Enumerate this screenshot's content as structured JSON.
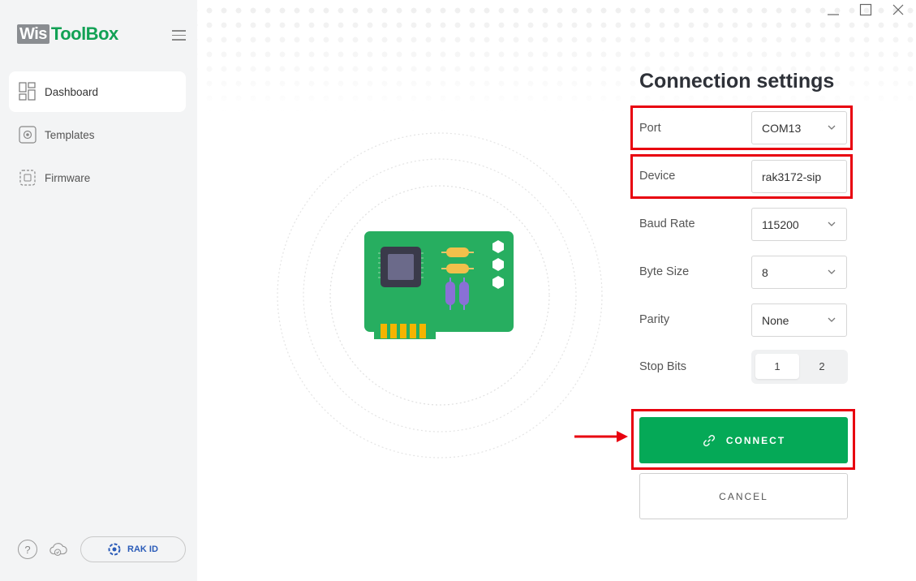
{
  "app": {
    "logo_wis": "Wis",
    "logo_toolbox": "ToolBox"
  },
  "sidebar": {
    "items": [
      {
        "label": "Dashboard",
        "icon": "dashboard-icon",
        "active": true
      },
      {
        "label": "Templates",
        "icon": "templates-icon",
        "active": false
      },
      {
        "label": "Firmware",
        "icon": "chip-icon",
        "active": false
      }
    ],
    "help_icon": "?",
    "rak_id_label": "RAK ID"
  },
  "panel": {
    "title": "Connection settings",
    "port": {
      "label": "Port",
      "value": "COM13"
    },
    "device": {
      "label": "Device",
      "value": "rak3172-sip"
    },
    "baud_rate": {
      "label": "Baud Rate",
      "value": "115200"
    },
    "byte_size": {
      "label": "Byte Size",
      "value": "8"
    },
    "parity": {
      "label": "Parity",
      "value": "None"
    },
    "stop_bits": {
      "label": "Stop Bits",
      "options": [
        "1",
        "2"
      ],
      "selected": "1"
    },
    "connect_label": "CONNECT",
    "cancel_label": "CANCEL"
  },
  "colors": {
    "brand_green": "#05a957",
    "highlight_red": "#e8000f",
    "sidebar_bg": "#f3f4f5"
  }
}
